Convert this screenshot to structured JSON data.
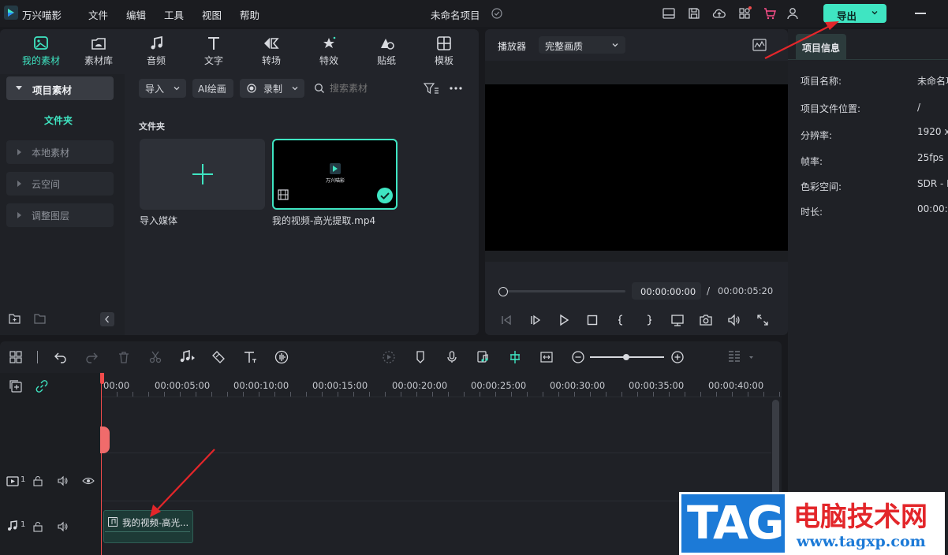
{
  "app": {
    "name": "万兴喵影",
    "project_title": "未命名项目"
  },
  "menu": [
    "文件",
    "编辑",
    "工具",
    "视图",
    "帮助"
  ],
  "export": {
    "label": "导出"
  },
  "categories": [
    "我的素材",
    "素材库",
    "音频",
    "文字",
    "转场",
    "特效",
    "贴纸",
    "模板"
  ],
  "sidebar": {
    "project_media": "项目素材",
    "folder": "文件夹",
    "items": [
      "本地素材",
      "云空间",
      "调整图层"
    ]
  },
  "toolbar": {
    "import": "导入",
    "ai_paint": "AI绘画",
    "record": "录制",
    "search_placeholder": "搜索素材"
  },
  "media": {
    "section_title": "文件夹",
    "import_card_label": "导入媒体",
    "clip_name": "我的视频-高光提取.mp4",
    "thumb_logo_text": "万兴喵影"
  },
  "player": {
    "tab": "播放器",
    "quality": "完整画质",
    "current_time": "00:00:00:00",
    "separator": "/",
    "total_time": "00:00:05:20"
  },
  "info": {
    "tab": "项目信息",
    "rows": [
      {
        "label": "项目名称:",
        "value": "未命名项"
      },
      {
        "label": "项目文件位置:",
        "value": "/"
      },
      {
        "label": "分辨率:",
        "value": "1920 x"
      },
      {
        "label": "帧率:",
        "value": "25fps"
      },
      {
        "label": "色彩空间:",
        "value": "SDR - I"
      },
      {
        "label": "时长:",
        "value": "00:00:0"
      }
    ]
  },
  "timeline": {
    "ruler": [
      "00:00",
      "00:00:05:00",
      "00:00:10:00",
      "00:00:15:00",
      "00:00:20:00",
      "00:00:25:00",
      "00:00:30:00",
      "00:00:35:00",
      "00:00:40:00"
    ],
    "video_track_num": "1",
    "audio_track_num": "1",
    "audio_clip_label": "我的视频-高光..."
  },
  "watermark": {
    "tag": "TAG",
    "site_name": "电脑技术网",
    "url": "www.tagxp.com"
  },
  "colors": {
    "accent": "#3fe5c2",
    "playhead": "#f04b4b",
    "annotation": "#e3262a"
  }
}
